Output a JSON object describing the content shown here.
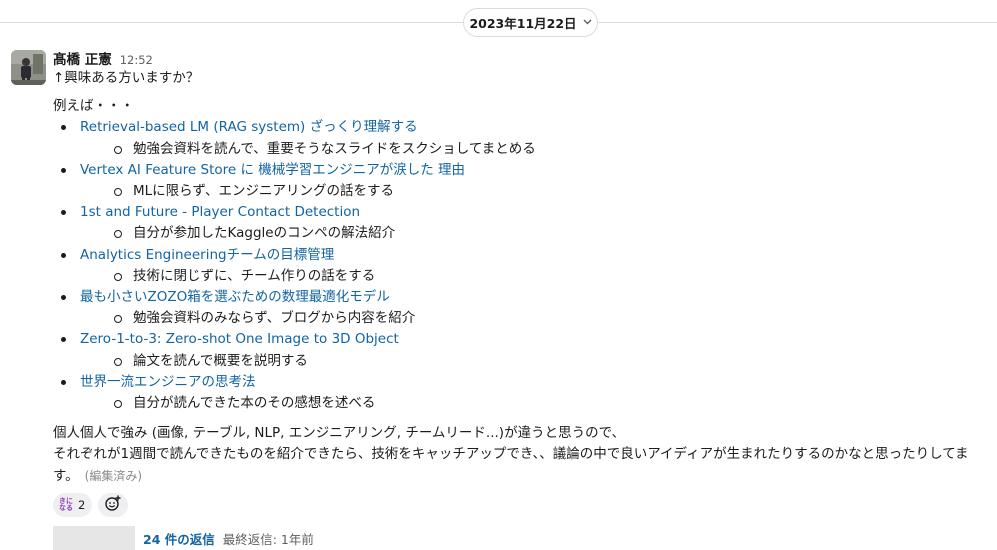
{
  "date_divider": {
    "label": "2023年11月22日",
    "chevron_icon": "chevron-down-icon"
  },
  "message": {
    "author": "髙橋 正憲",
    "time": "12:52",
    "line1": "↑興味ある方いますか？",
    "example_intro": "例えば・・・",
    "items": [
      {
        "title": "Retrieval-based LM (RAG system) ざっくり理解する",
        "note": "勉強会資料を読んで、重要そうなスライドをスクショしてまとめる"
      },
      {
        "title": "Vertex AI Feature Store に 機械学習エンジニアが涙した 理由",
        "note": "MLに限らず、エンジニアリングの話をする"
      },
      {
        "title": "1st and Future - Player Contact Detection",
        "note": "自分が参加したKaggleのコンペの解法紹介"
      },
      {
        "title": "Analytics Engineeringチームの目標管理",
        "note": "技術に閉じずに、チーム作りの話をする"
      },
      {
        "title": "最も小さいZOZO箱を選ぶための数理最適化モデル",
        "note": "勉強会資料のみならず、ブログから内容を紹介"
      },
      {
        "title": "Zero-1-to-3: Zero-shot One Image to 3D Object",
        "note": "論文を読んで概要を説明する"
      },
      {
        "title": "世界一流エンジニアの思考法",
        "note": "自分が読んできた本のその感想を述べる"
      }
    ],
    "para1": "個人個人で強み (画像, テーブル, NLP, エンジニアリング, チームリード...)が違うと思うので、",
    "para2": "それぞれが1週間で読んできたものを紹介できたら、技術をキャッチアップでき、、議論の中で良いアイディアが生まれたりするのかなと思ったりしてま",
    "para3": "す。",
    "edited": "(編集済み)",
    "reaction": {
      "emoji_label": "きになる",
      "emoji_top": "きに",
      "emoji_bottom": "なる",
      "count": "2"
    },
    "add_reaction_icon": "add-reaction-icon",
    "thread": {
      "reply_count": "24 件の返信",
      "last_reply": "最終返信: 1年前"
    }
  },
  "colors": {
    "link": "#1264a3",
    "text": "#1d1c1d",
    "muted": "#616061"
  }
}
